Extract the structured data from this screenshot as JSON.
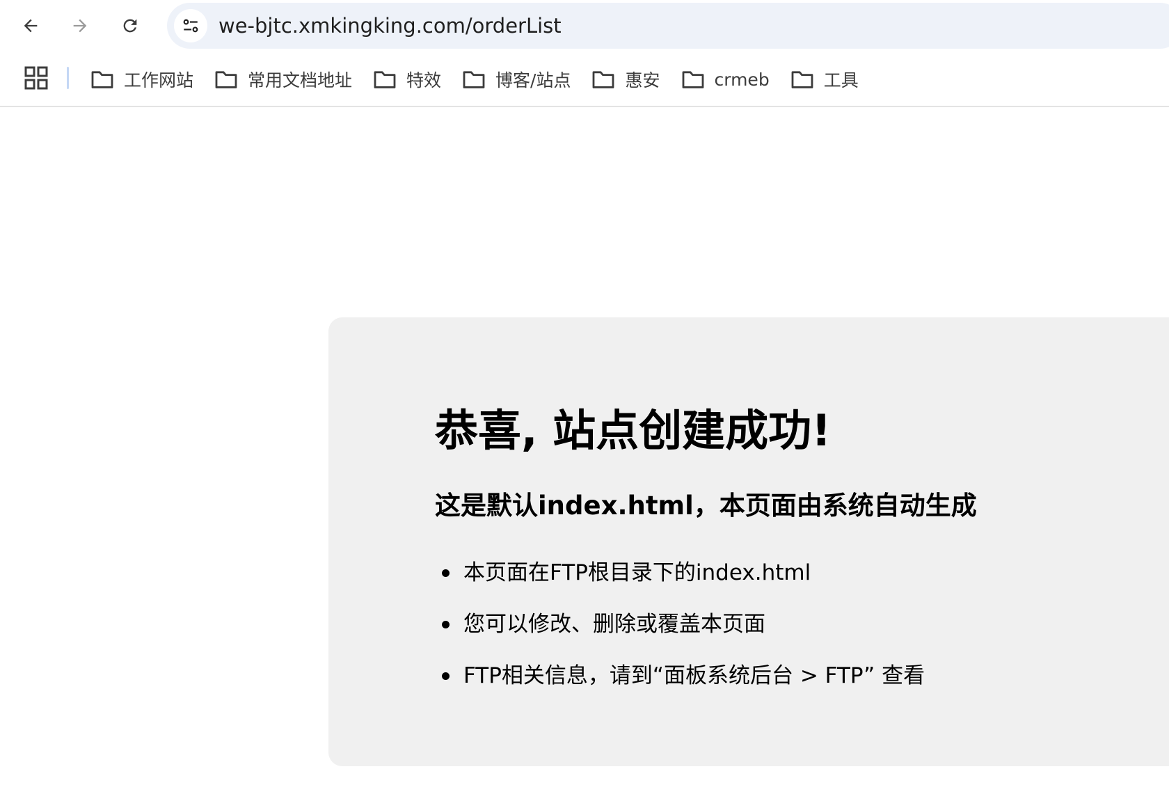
{
  "browser": {
    "url": "we-bjtc.xmkingking.com/orderList",
    "nav": {
      "back_icon": "arrow-left-icon",
      "forward_icon": "arrow-right-icon",
      "reload_icon": "reload-icon",
      "site_info_icon": "tune-icon"
    },
    "bookmarks": [
      {
        "label": "工作网站",
        "icon": "folder-icon"
      },
      {
        "label": "常用文档地址",
        "icon": "folder-icon"
      },
      {
        "label": "特效",
        "icon": "folder-icon"
      },
      {
        "label": "博客/站点",
        "icon": "folder-icon"
      },
      {
        "label": "惠安",
        "icon": "folder-icon"
      },
      {
        "label": "crmeb",
        "icon": "folder-icon"
      },
      {
        "label": "工具",
        "icon": "folder-icon"
      }
    ],
    "apps_icon": "apps-grid-icon"
  },
  "page": {
    "title": "恭喜, 站点创建成功!",
    "subtitle": "这是默认index.html，本页面由系统自动生成",
    "items": [
      "本页面在FTP根目录下的index.html",
      "您可以修改、删除或覆盖本页面",
      "FTP相关信息，请到“面板系统后台 > FTP” 查看"
    ]
  },
  "colors": {
    "omnibox_bg": "#eef2f9",
    "card_bg": "#f0f0f0",
    "bookmark_separator": "#c4d7f5"
  }
}
